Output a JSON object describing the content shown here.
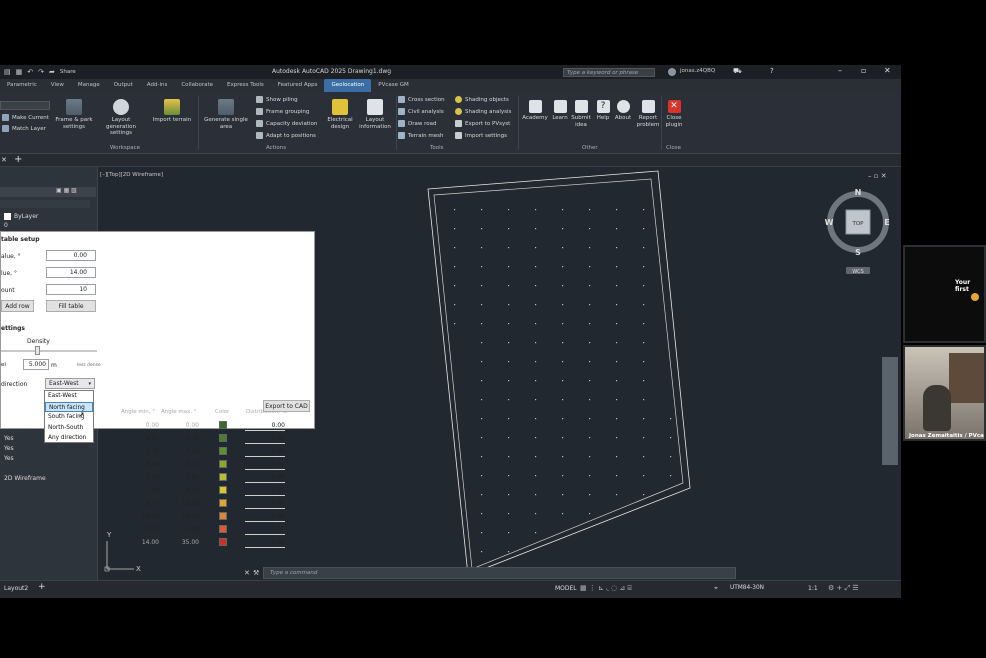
{
  "window": {
    "title": "Autodesk AutoCAD 2025   Drawing1.dwg",
    "share_label": "Share",
    "search_placeholder": "Type a keyword or phrase",
    "user": "jonas.z4QBQ",
    "minimize": "–",
    "restore": "▫",
    "close": "✕"
  },
  "ribbon_tabs": [
    "Parametric",
    "View",
    "Manage",
    "Output",
    "Add-ins",
    "Collaborate",
    "Express Tools",
    "Featured Apps",
    "Geolocation",
    "PVcase GM"
  ],
  "ribbon_active_tab": "Geolocation",
  "ribbon": {
    "left_items": [
      "Make Current",
      "Match Layer"
    ],
    "workspace": {
      "frame_park": "Frame & park settings",
      "layout_gen": "Layout generation settings",
      "import_terrain": "Import terrain",
      "group_label": "Workspace"
    },
    "actions": {
      "generate_single": "Generate single area",
      "show_piling": "Show piling",
      "frame_grouping": "Frame grouping",
      "capacity_deviation": "Capacity deviation",
      "adapt_positions": "Adapt to positions",
      "electrical_design": "Electrical design",
      "layout_information": "Layout information",
      "group_label": "Actions"
    },
    "tools": {
      "cross_section": "Cross section",
      "civil_analysis": "Civil analysis",
      "draw_road": "Draw road",
      "terrain_mesh": "Terrain mesh",
      "shading_objects": "Shading objects",
      "shading_analysis": "Shading analysis",
      "export_pvsyst": "Export to PVsyst",
      "import_settings": "Import settings",
      "group_label": "Tools"
    },
    "other": {
      "academy": "Academy",
      "learn": "Learn",
      "submit_idea": "Submit idea",
      "help": "Help",
      "about": "About",
      "report_problem": "Report problem",
      "group_label": "Other"
    },
    "close": {
      "close_plugin": "Close plugin",
      "group_label": "Close"
    }
  },
  "palette": {
    "bylayer": "ByLayer",
    "zero": "0",
    "yes_values": [
      "Yes",
      "Yes",
      "Yes"
    ],
    "visual_style": "2D Wireframe"
  },
  "viewport_label": "[–][Top][2D Wireframe]",
  "viewcube": {
    "n": "N",
    "s": "S",
    "e": "E",
    "w": "W",
    "top": "TOP",
    "wcs": "WCS"
  },
  "dialog": {
    "section_table": "table setup",
    "min_value_label": "alue, °",
    "min_value": "0.00",
    "max_value_label": "lue, °",
    "max_value": "14.00",
    "count_label": "ount",
    "count": "10",
    "add_row": "Add row",
    "fill_table": "Fill table",
    "section_settings": "ettings",
    "density_label": "Density",
    "resolution_label": "el",
    "resolution_value": "5.000",
    "unit": "m",
    "less_dense": "less dense",
    "direction_label": "direction",
    "direction_value": "East-West",
    "direction_options": [
      "East-West",
      "North facing",
      "South facing",
      "North-South",
      "Any direction"
    ],
    "direction_highlight": "North facing",
    "export_cad": "Export to CAD",
    "headers": [
      "Angle min, °",
      "Angle max, °",
      "Color",
      "Distribution, %"
    ],
    "rows": [
      {
        "min": "0.00",
        "max": "0.00",
        "color": "#3a6b2a",
        "dist": "0.00"
      },
      {
        "min": "0.00",
        "max": "1.75",
        "color": "#4b7d2b",
        "dist": "0.00"
      },
      {
        "min": "1.75",
        "max": "3.50",
        "color": "#5f8f2c",
        "dist": "0.00"
      },
      {
        "min": "3.50",
        "max": "5.25",
        "color": "#8aa82c",
        "dist": "0.00"
      },
      {
        "min": "5.25",
        "max": "7.00",
        "color": "#b9bf2d",
        "dist": "0.00"
      },
      {
        "min": "7.00",
        "max": "8.75",
        "color": "#d8c62e",
        "dist": "0.00"
      },
      {
        "min": "8.75",
        "max": "10.50",
        "color": "#e2a52f",
        "dist": "0.00"
      },
      {
        "min": "10.50",
        "max": "12.25",
        "color": "#e08534",
        "dist": "0.00"
      },
      {
        "min": "12.25",
        "max": "14.00",
        "color": "#dc5a35",
        "dist": "0.00"
      },
      {
        "min": "14.00",
        "max": "35.00",
        "color": "#c9302c",
        "dist": "0.00"
      }
    ]
  },
  "command_placeholder": "Type a command",
  "status": {
    "layout_tab": "Layout2",
    "add_tab": "+",
    "model": "MODEL",
    "coord_system": "UTM84-30N",
    "scale": "1:1"
  },
  "video": {
    "top_text": "Your first",
    "presenter": "Jonas Zemaitaitis / PVca"
  }
}
